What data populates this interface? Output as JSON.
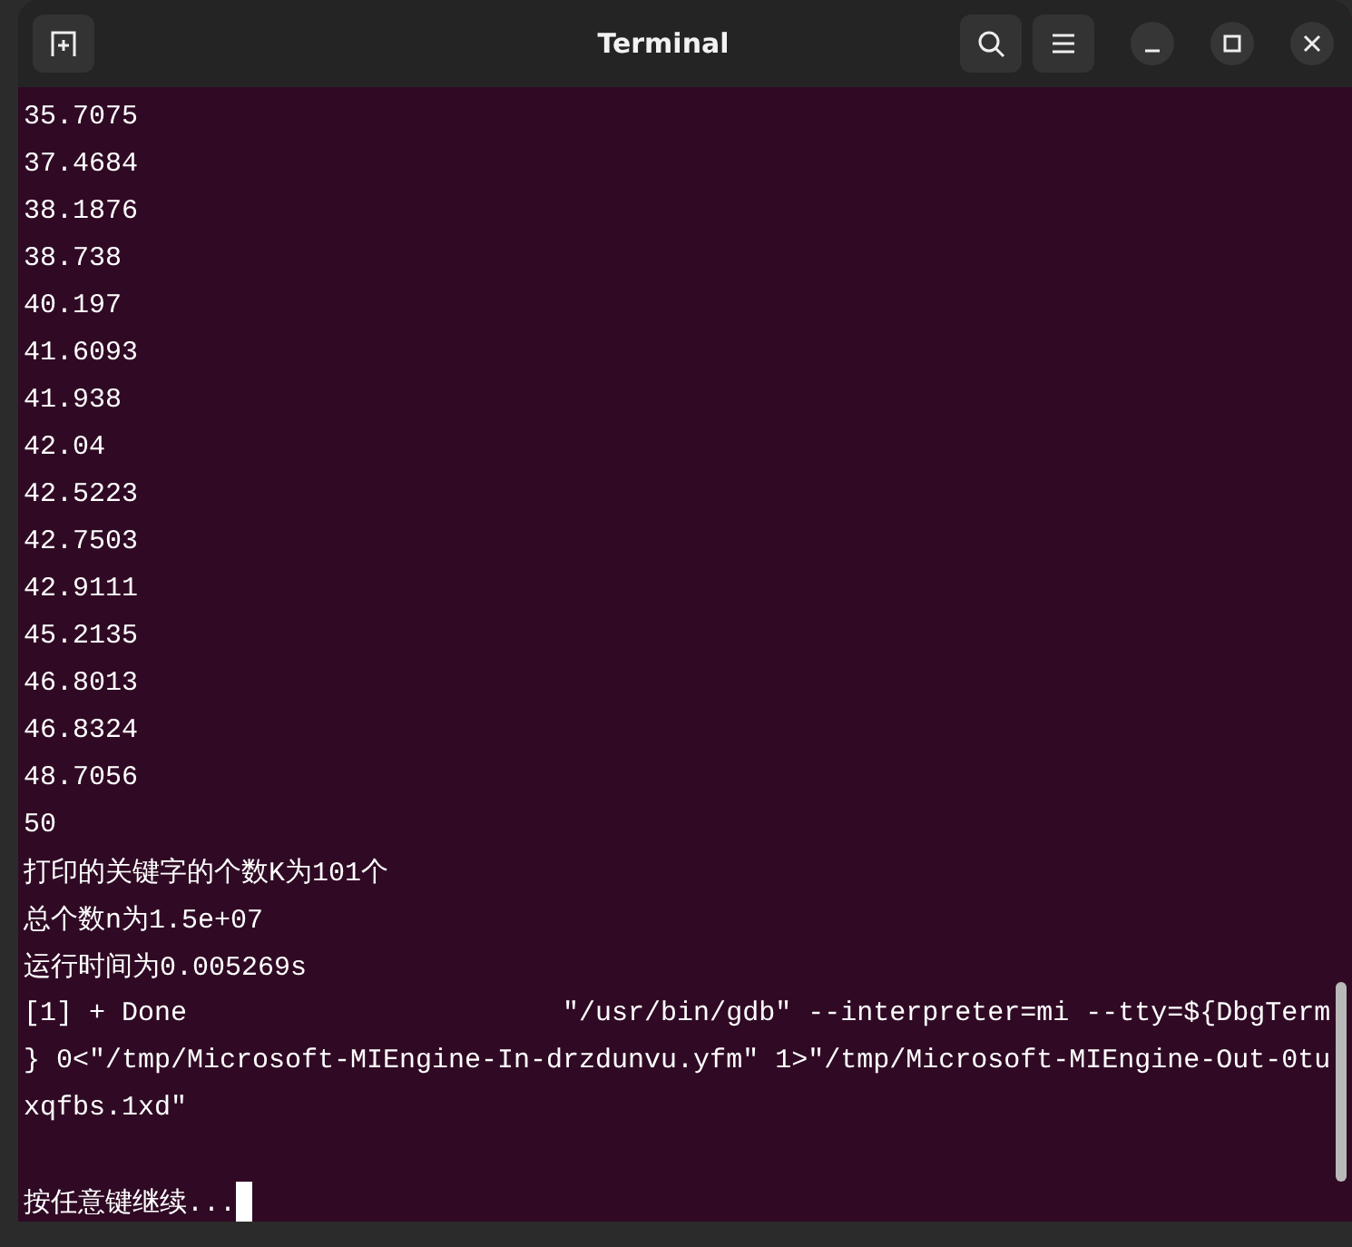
{
  "window": {
    "title": "Terminal"
  },
  "lines": [
    {
      "kind": "output",
      "text": "35.7075"
    },
    {
      "kind": "output",
      "text": "37.4684"
    },
    {
      "kind": "output",
      "text": "38.1876"
    },
    {
      "kind": "output",
      "text": "38.738"
    },
    {
      "kind": "output",
      "text": "40.197"
    },
    {
      "kind": "output",
      "text": "41.6093"
    },
    {
      "kind": "output",
      "text": "41.938"
    },
    {
      "kind": "output",
      "text": "42.04"
    },
    {
      "kind": "output",
      "text": "42.5223"
    },
    {
      "kind": "output",
      "text": "42.7503"
    },
    {
      "kind": "output",
      "text": "42.9111"
    },
    {
      "kind": "output",
      "text": "45.2135"
    },
    {
      "kind": "output",
      "text": "46.8013"
    },
    {
      "kind": "output",
      "text": "46.8324"
    },
    {
      "kind": "output",
      "text": "48.7056"
    },
    {
      "kind": "output",
      "text": "50"
    },
    {
      "kind": "output",
      "text": "打印的关键字的个数K为101个"
    },
    {
      "kind": "output",
      "text": "总个数n为1.5e+07"
    },
    {
      "kind": "output",
      "text": "运行时间为0.005269s"
    },
    {
      "kind": "output",
      "text": "[1] + Done                       \"/usr/bin/gdb\" --interpreter=mi --tty=${DbgTerm"
    },
    {
      "kind": "output",
      "text": "} 0<\"/tmp/Microsoft-MIEngine-In-drzdunvu.yfm\" 1>\"/tmp/Microsoft-MIEngine-Out-0tu"
    },
    {
      "kind": "output",
      "text": "xqfbs.1xd\""
    },
    {
      "kind": "prompt",
      "text": "按任意键继续..."
    }
  ]
}
